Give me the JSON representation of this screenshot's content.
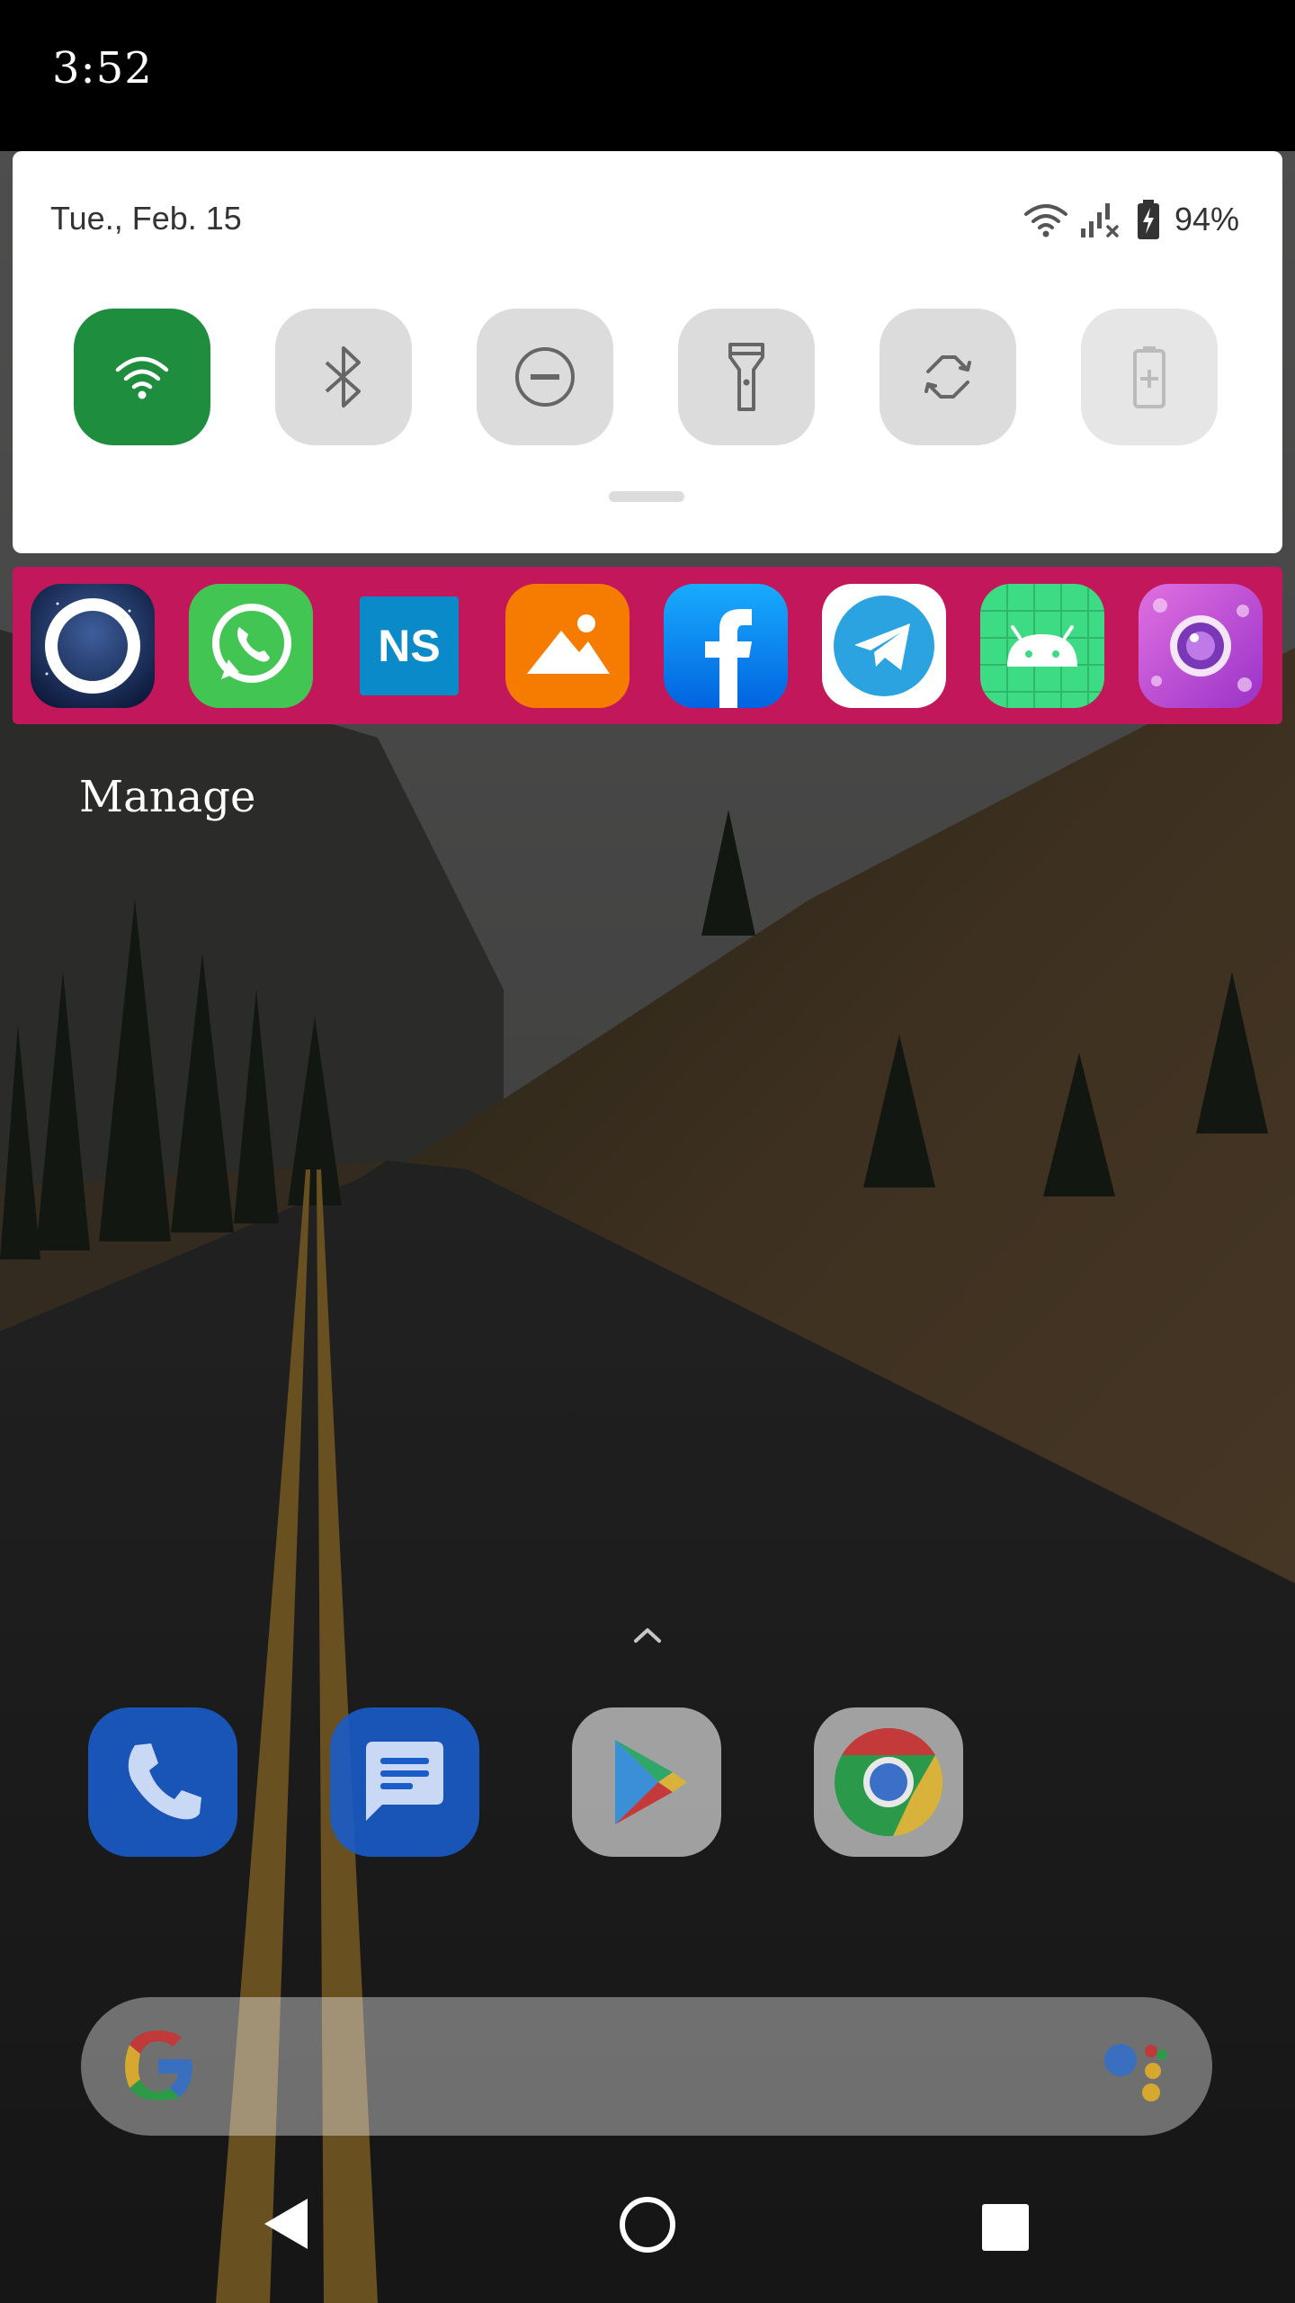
{
  "status_bar": {
    "time": "3:52"
  },
  "quick_settings": {
    "date": "Tue., Feb. 15",
    "battery_percent": "94%",
    "tiles": [
      {
        "name": "wifi",
        "icon": "wifi-icon",
        "active": true
      },
      {
        "name": "bluetooth",
        "icon": "bluetooth-icon",
        "active": false
      },
      {
        "name": "do-not-disturb",
        "icon": "do-not-disturb-icon",
        "active": false
      },
      {
        "name": "flashlight",
        "icon": "flashlight-icon",
        "active": false
      },
      {
        "name": "auto-rotate",
        "icon": "auto-rotate-icon",
        "active": false
      },
      {
        "name": "battery-saver",
        "icon": "battery-saver-icon",
        "active": false,
        "disabled": true
      }
    ],
    "colors": {
      "active_tile": "#1e8e3e",
      "inactive_tile": "#dcdcdc"
    }
  },
  "app_strip": {
    "background": "#c2185b",
    "apps": [
      {
        "icon": "night-sky-app-icon"
      },
      {
        "icon": "whatsapp-icon"
      },
      {
        "icon": "ns-app-icon",
        "text": "NS"
      },
      {
        "icon": "gallery-icon"
      },
      {
        "icon": "facebook-icon"
      },
      {
        "icon": "telegram-icon"
      },
      {
        "icon": "android-app-icon"
      },
      {
        "icon": "camera-app-icon"
      }
    ]
  },
  "manage": {
    "label": "Manage"
  },
  "dock": {
    "apps": [
      {
        "icon": "phone-icon"
      },
      {
        "icon": "messages-icon"
      },
      {
        "icon": "play-store-icon"
      },
      {
        "icon": "chrome-icon"
      }
    ]
  },
  "search_bar": {
    "logo": "google-g-icon",
    "assistant": "google-assistant-icon"
  },
  "nav_bar": {
    "buttons": [
      "back-icon",
      "home-icon",
      "recents-icon"
    ]
  }
}
